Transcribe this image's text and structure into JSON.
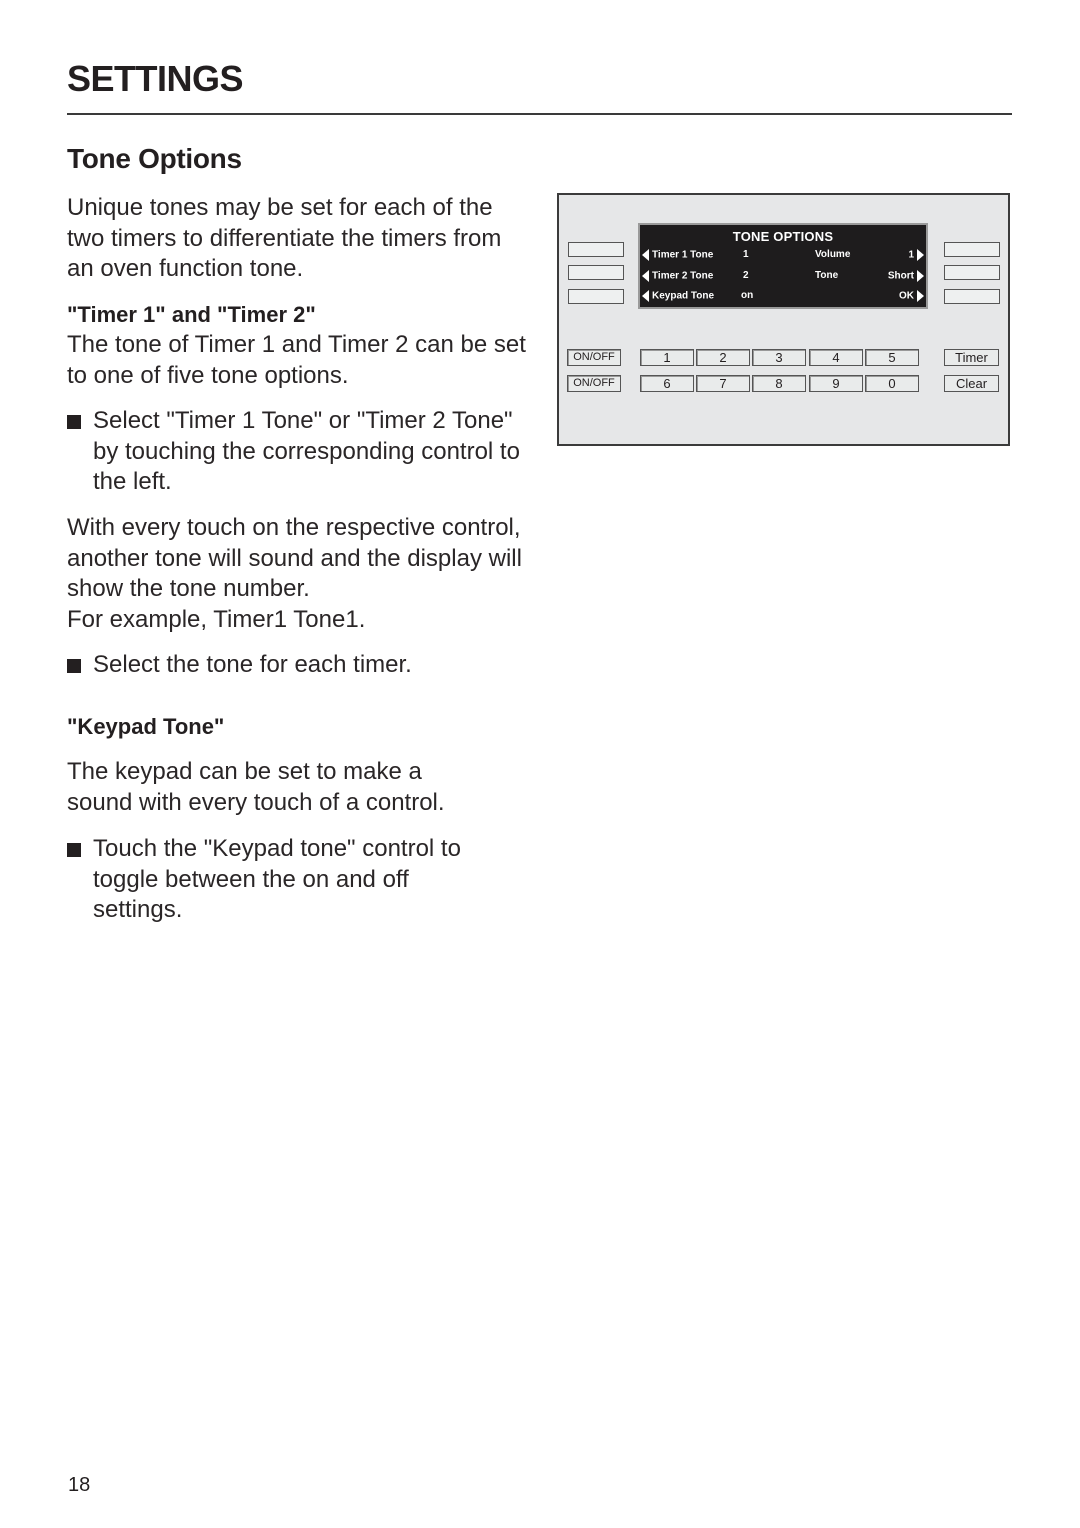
{
  "header": {
    "section_title": "SETTINGS",
    "page_heading": "Tone Options"
  },
  "content": {
    "intro": "Unique tones may be set for each of the two timers to differentiate the timers from an oven function tone.",
    "timer_section": {
      "heading": "\"Timer 1\" and \"Timer 2\"",
      "text": "The tone of Timer 1 and Timer 2 can be set to one of five tone options.",
      "bullet": "Select \"Timer 1 Tone\" or \"Timer 2 Tone\" by touching the corresponding control to the left.",
      "followup_lines": [
        "With every touch on the respective control, another tone will sound and the display will show the tone number.",
        "For example, Timer1 Tone1."
      ],
      "bullet2": "Select the tone for each timer."
    },
    "keypad_section": {
      "heading": "\"Keypad Tone\"",
      "text": "The keypad can be set to make a sound with every touch of a control.",
      "bullet": "Touch the \"Keypad tone\" control to toggle between the on and off settings."
    }
  },
  "panel": {
    "display": {
      "title": "TONE OPTIONS",
      "rows": [
        {
          "left_label": "Timer 1 Tone",
          "left_value": "1",
          "right_label": "Volume",
          "right_value": "1"
        },
        {
          "left_label": "Timer 2 Tone",
          "left_value": "2",
          "right_label": "Tone",
          "right_value": "Short"
        },
        {
          "left_label": "Keypad Tone",
          "left_value": "on",
          "right_label": "",
          "right_value": "OK"
        }
      ]
    },
    "onoff_labels": [
      "ON/OFF",
      "ON/OFF"
    ],
    "keypad_row1": [
      "1",
      "2",
      "3",
      "4",
      "5"
    ],
    "keypad_row2": [
      "6",
      "7",
      "8",
      "9",
      "0"
    ],
    "timer_label": "Timer",
    "clear_label": "Clear"
  },
  "footer": {
    "page_number": "18"
  }
}
